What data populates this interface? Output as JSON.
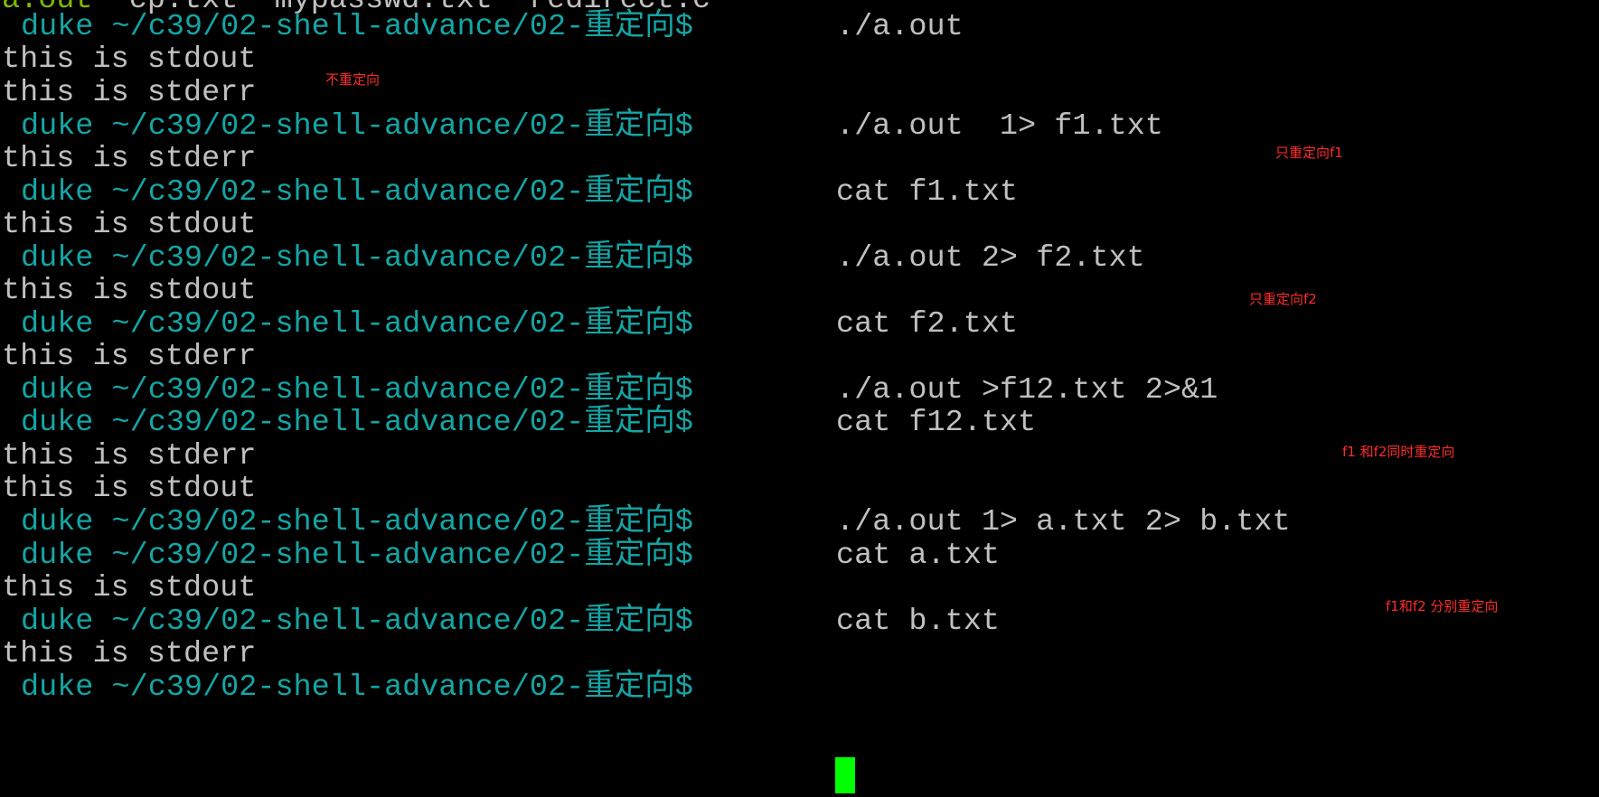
{
  "terminal": {
    "partial_top": {
      "green": "a.out",
      "rest": "  cp.txt  mypasswd.txt  redirect.c"
    },
    "prompt": "duke ~/c39/02-shell-advance/02-重定向$",
    "lines": [
      {
        "kind": "cmd",
        "text": "./a.out"
      },
      {
        "kind": "out",
        "text": "this is stdout"
      },
      {
        "kind": "out",
        "text": "this is stderr"
      },
      {
        "kind": "cmd",
        "text": "./a.out  1> f1.txt"
      },
      {
        "kind": "out",
        "text": "this is stderr"
      },
      {
        "kind": "cmd",
        "text": "cat f1.txt"
      },
      {
        "kind": "out",
        "text": "this is stdout"
      },
      {
        "kind": "cmd",
        "text": "./a.out 2> f2.txt"
      },
      {
        "kind": "out",
        "text": "this is stdout"
      },
      {
        "kind": "cmd",
        "text": "cat f2.txt"
      },
      {
        "kind": "out",
        "text": "this is stderr"
      },
      {
        "kind": "cmd",
        "text": "./a.out >f12.txt 2>&1"
      },
      {
        "kind": "cmd",
        "text": "cat f12.txt"
      },
      {
        "kind": "out",
        "text": "this is stderr"
      },
      {
        "kind": "out",
        "text": "this is stdout"
      },
      {
        "kind": "cmd",
        "text": "./a.out 1> a.txt 2> b.txt"
      },
      {
        "kind": "cmd",
        "text": "cat a.txt"
      },
      {
        "kind": "out",
        "text": "this is stdout"
      },
      {
        "kind": "cmd",
        "text": "cat b.txt"
      },
      {
        "kind": "out",
        "text": "this is stderr"
      },
      {
        "kind": "cmd",
        "text": ""
      }
    ]
  },
  "annotations": {
    "no_redirect": "不重定向",
    "only_f1": "只重定向f1",
    "only_f2": "只重定向f2",
    "both_same": "f1 和f2同时重定向",
    "both_separate": "f1和f2 分别重定向"
  },
  "colors": {
    "background": "#000000",
    "prompt": "#14a5a5",
    "output": "#c0c0c0",
    "annotation": "#ff2a2a",
    "cursor": "#00ff00"
  }
}
